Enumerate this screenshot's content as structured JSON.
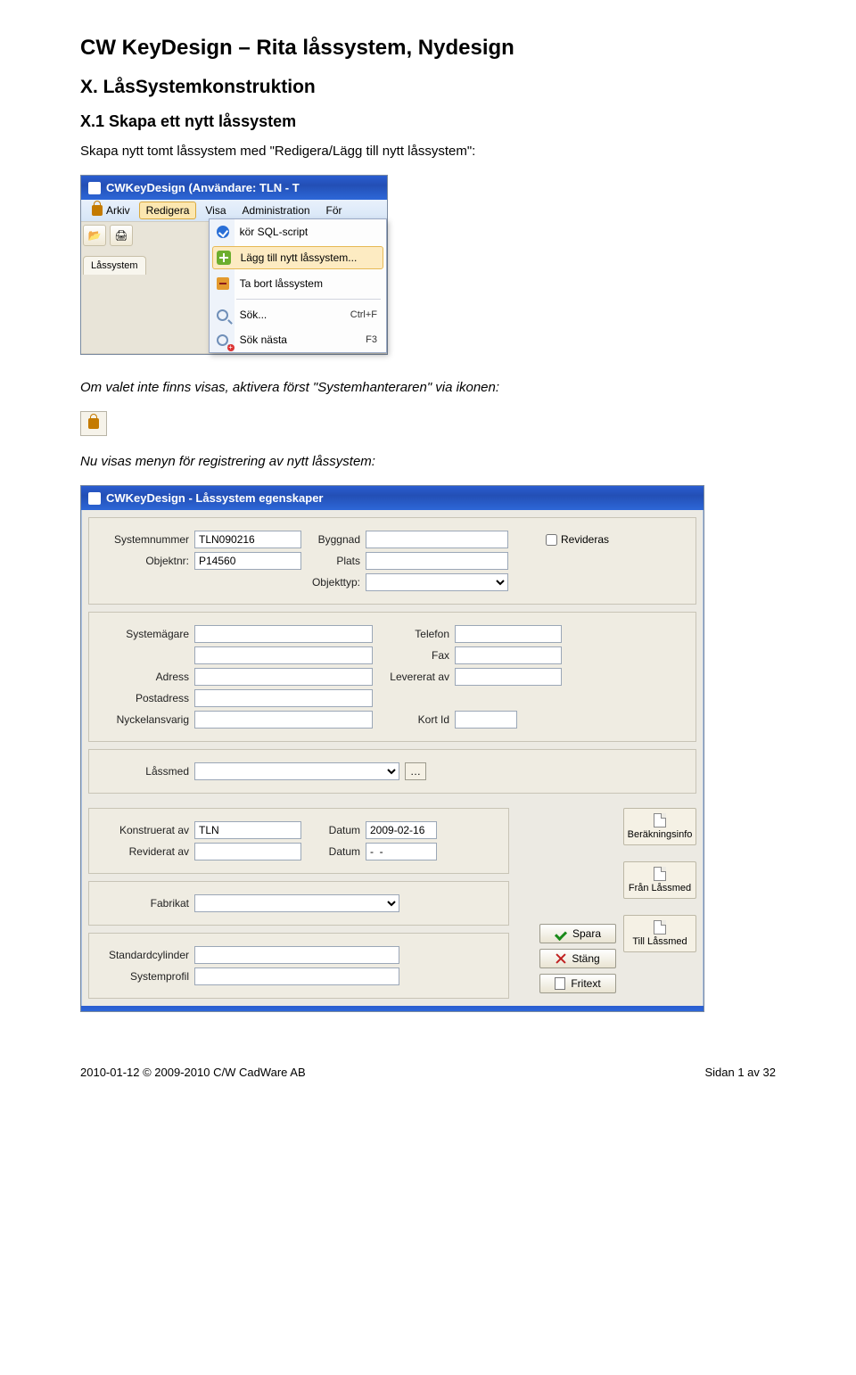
{
  "doc": {
    "h1": "CW KeyDesign – Rita låssystem, Nydesign",
    "h2": "X. LåsSystemkonstruktion",
    "h3": "X.1 Skapa ett nytt låssystem",
    "intro": "Skapa nytt tomt låssystem med \"Redigera/Lägg till nytt låssystem\":",
    "note1": "Om valet inte finns visas, aktivera först \"Systemhanteraren\" via ikonen:",
    "note2": "Nu visas menyn för registrering av nytt låssystem:"
  },
  "shot1": {
    "title": "CWKeyDesign    (Användare: TLN - T",
    "menu": {
      "arkiv": "Arkiv",
      "redigera": "Redigera",
      "visa": "Visa",
      "admin": "Administration",
      "for": "För"
    },
    "tab": "Låssystem",
    "popup": {
      "sql": "kör SQL-script",
      "add": "Lägg till nytt låssystem...",
      "del": "Ta bort låssystem",
      "search": "Sök...",
      "search_sc": "Ctrl+F",
      "searchnext": "Sök nästa",
      "searchnext_sc": "F3"
    }
  },
  "shot2": {
    "title": "CWKeyDesign - Låssystem egenskaper",
    "labels": {
      "sysnr": "Systemnummer",
      "byggnad": "Byggnad",
      "revideras": "Revideras",
      "objnr": "Objektnr:",
      "plats": "Plats",
      "objtyp": "Objekttyp:",
      "owner": "Systemägare",
      "tel": "Telefon",
      "fax": "Fax",
      "addr": "Adress",
      "lev": "Levererat av",
      "post": "Postadress",
      "nyckel": "Nyckelansvarig",
      "kortid": "Kort Id",
      "smed": "Låssmed",
      "konstr": "Konstruerat av",
      "datum": "Datum",
      "revav": "Reviderat av",
      "fabrikat": "Fabrikat",
      "stdcyl": "Standardcylinder",
      "sysprof": "Systemprofil"
    },
    "values": {
      "sysnr": "TLN090216",
      "objnr": "P14560",
      "konstr": "TLN",
      "datum1": "2009-02-16",
      "datum2": "-  -"
    },
    "buttons": {
      "berinfo": "Beräkningsinfo",
      "franlas": "Från Låssmed",
      "tilllas": "Till Låssmed",
      "spara": "Spara",
      "stang": "Stäng",
      "fritext": "Fritext"
    }
  },
  "footer": {
    "left": "2010-01-12  © 2009-2010 C/W CadWare AB",
    "right": "Sidan 1 av 32"
  }
}
